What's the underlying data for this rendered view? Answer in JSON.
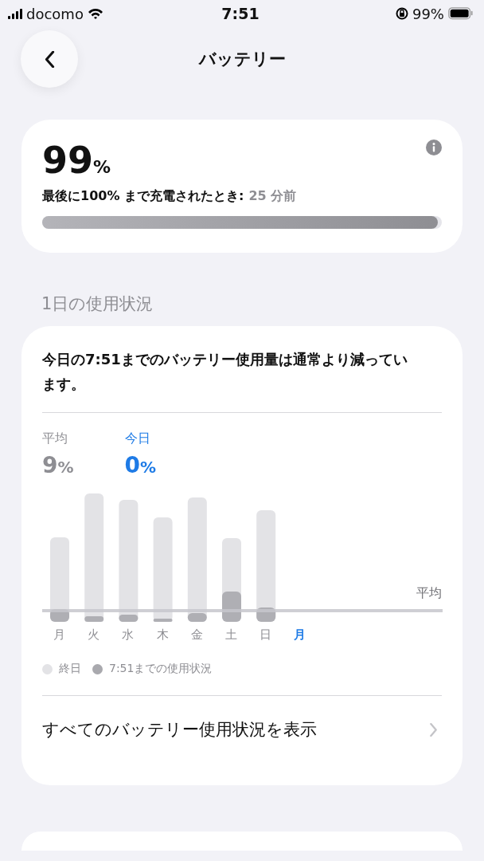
{
  "status_bar": {
    "carrier": "docomo",
    "time": "7:51",
    "battery": "99%"
  },
  "nav": {
    "title": "バッテリー"
  },
  "level_card": {
    "percent": "99",
    "unit": "%",
    "last_charged_label": "最後に100% まで充電されたとき:",
    "last_charged_value": "25 分前",
    "level": 0.99
  },
  "section_title": "1日の使用状況",
  "usage_card": {
    "summary": "今日の7:51までのバッテリー使用量は通常より減っています。",
    "stats": [
      {
        "label": "平均",
        "value": "9",
        "unit": "%",
        "selected": false
      },
      {
        "label": "今日",
        "value": "0",
        "unit": "%",
        "selected": true
      }
    ],
    "average_label": "平均",
    "days": [
      {
        "label": "月",
        "selected": false
      },
      {
        "label": "火",
        "selected": false
      },
      {
        "label": "水",
        "selected": false
      },
      {
        "label": "木",
        "selected": false
      },
      {
        "label": "金",
        "selected": false
      },
      {
        "label": "土",
        "selected": false
      },
      {
        "label": "日",
        "selected": false
      },
      {
        "label": "月",
        "selected": true
      }
    ],
    "legend": [
      {
        "label": "終日",
        "color": "#e3e3e6"
      },
      {
        "label": "7:51までの使用状況",
        "color": "#a9a9ae"
      }
    ],
    "link": "すべてのバッテリー使用状況を表示"
  }
}
